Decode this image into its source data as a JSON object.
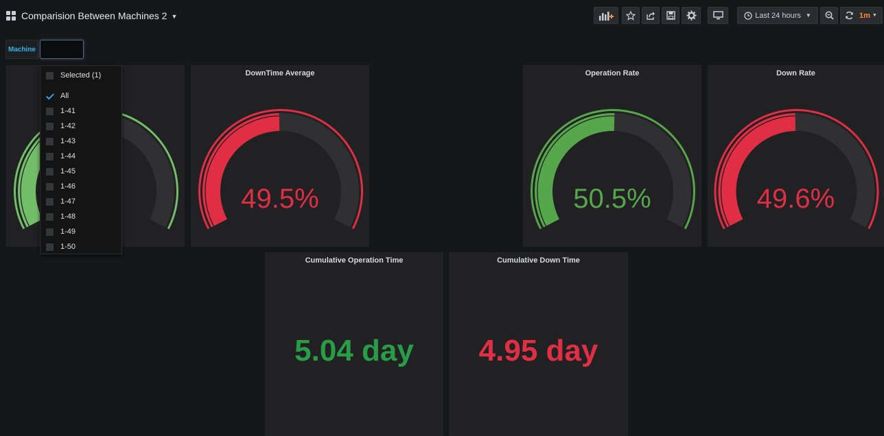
{
  "dashboard": {
    "title": "Comparision Between Machines 2",
    "toolbar": {
      "add_panel_icon": "bar-chart-plus-icon",
      "star_icon": "star-icon",
      "share_icon": "share-icon",
      "save_icon": "save-icon",
      "settings_icon": "gear-icon",
      "tv_mode_icon": "monitor-icon",
      "time_range_label": "Last 24 hours",
      "zoom_icon": "zoom-out-icon",
      "refresh_interval": "1m"
    }
  },
  "variables": {
    "machine": {
      "label": "Machine",
      "value": "",
      "dropdown": {
        "selected_header": "Selected (1)",
        "options": [
          {
            "label": "All",
            "checked": true
          },
          {
            "label": "1-41",
            "checked": false
          },
          {
            "label": "1-42",
            "checked": false
          },
          {
            "label": "1-43",
            "checked": false
          },
          {
            "label": "1-44",
            "checked": false
          },
          {
            "label": "1-45",
            "checked": false
          },
          {
            "label": "1-46",
            "checked": false
          },
          {
            "label": "1-47",
            "checked": false
          },
          {
            "label": "1-48",
            "checked": false
          },
          {
            "label": "1-49",
            "checked": false
          },
          {
            "label": "1-50",
            "checked": false
          }
        ]
      }
    }
  },
  "panels": {
    "operation_average": {
      "title_visible": "ge",
      "value": "%",
      "percent": 50.5,
      "color": "#73bf69"
    },
    "downtime_average": {
      "title": "DownTime Average",
      "value": "49.5%",
      "percent": 49.5,
      "color": "#e02f44"
    },
    "operation_rate": {
      "title": "Operation Rate",
      "value": "50.5%",
      "percent": 50.5,
      "color": "#56a64b"
    },
    "down_rate": {
      "title": "Down Rate",
      "value": "49.6%",
      "percent": 49.6,
      "color": "#e02f44"
    },
    "cumulative_operation_time": {
      "title": "Cumulative Operation Time",
      "value": "5.04 day",
      "color": "#299c46"
    },
    "cumulative_down_time": {
      "title": "Cumulative Down Time",
      "value": "4.95 day",
      "color": "#e02f44"
    }
  },
  "colors": {
    "background": "#161719",
    "panel": "#212124",
    "gauge_track": "#303033",
    "accent_blue": "#33b5e5",
    "refresh_orange": "#ff8833"
  }
}
